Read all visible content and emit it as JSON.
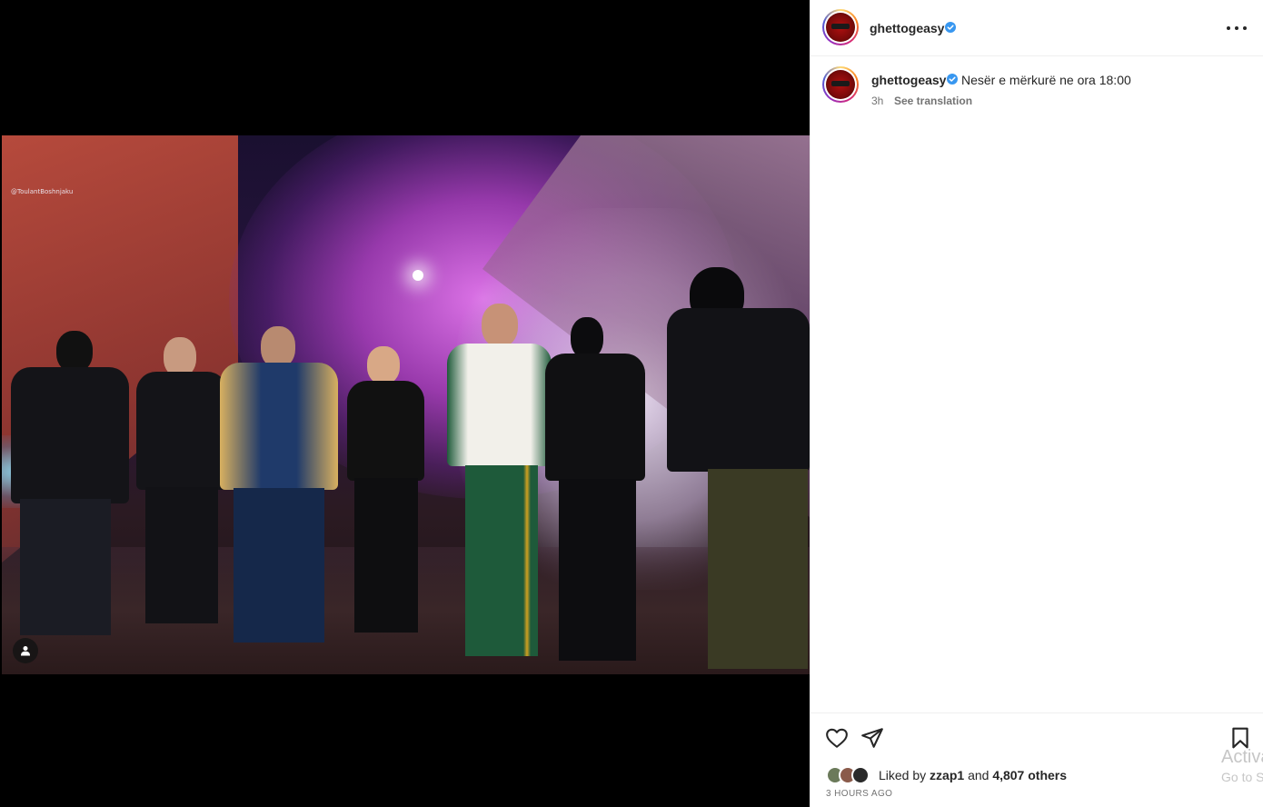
{
  "post": {
    "author": "ghettogeasy",
    "verified": true,
    "image_credit": "@ToulantBoshnjaku",
    "caption": "Nesër e mërkurë ne ora 18:00",
    "relative_time": "3h",
    "see_translation_label": "See translation"
  },
  "header": {
    "username": "ghettogeasy",
    "more_label": "More options"
  },
  "engagement": {
    "liked_by_prefix": "Liked by",
    "liked_by_user": "zzap1",
    "and_label": "and",
    "others_count": "4,807 others",
    "timestamp": "3 HOURS AGO"
  },
  "icons": {
    "like": "heart-icon",
    "share": "paper-plane-icon",
    "save": "bookmark-icon",
    "verified": "verified-badge-icon",
    "tag": "user-tag-icon",
    "more": "ellipsis-icon"
  },
  "colors": {
    "verified_blue": "#3897f0",
    "text_primary": "#262626",
    "text_secondary": "#737373",
    "divider": "#efefef"
  },
  "overlay": {
    "activation_line1": "Activate Windows",
    "activation_line2": "Go to Settings to activate Windows."
  }
}
